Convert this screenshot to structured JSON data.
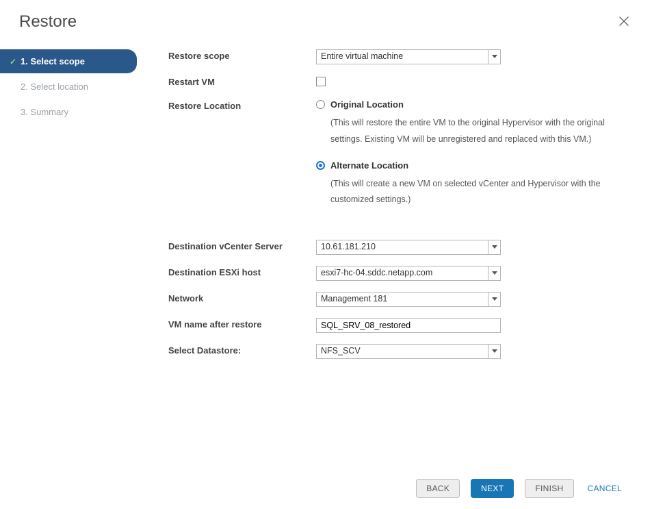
{
  "title": "Restore",
  "steps": [
    {
      "label": "1. Select scope",
      "status": "active"
    },
    {
      "label": "2. Select location",
      "status": "pending"
    },
    {
      "label": "3. Summary",
      "status": "pending"
    }
  ],
  "form": {
    "restore_scope_label": "Restore scope",
    "restore_scope_value": "Entire virtual machine",
    "restart_vm_label": "Restart VM",
    "restart_vm_checked": false,
    "restore_location_label": "Restore Location",
    "location_options": {
      "original": {
        "label": "Original Location",
        "description": "(This will restore the entire VM to the original Hypervisor with the original settings. Existing VM will be unregistered and replaced with this VM.)",
        "selected": false
      },
      "alternate": {
        "label": "Alternate Location",
        "description": "(This will create a new VM on selected vCenter and Hypervisor with the customized settings.)",
        "selected": true
      }
    },
    "dest_vcenter_label": "Destination vCenter Server",
    "dest_vcenter_value": "10.61.181.210",
    "dest_esxi_label": "Destination ESXi host",
    "dest_esxi_value": "esxi7-hc-04.sddc.netapp.com",
    "network_label": "Network",
    "network_value": "Management 181",
    "vm_name_label": "VM name after restore",
    "vm_name_value": "SQL_SRV_08_restored",
    "datastore_label": "Select Datastore:",
    "datastore_value": "NFS_SCV"
  },
  "buttons": {
    "back": "BACK",
    "next": "NEXT",
    "finish": "FINISH",
    "cancel": "CANCEL"
  }
}
